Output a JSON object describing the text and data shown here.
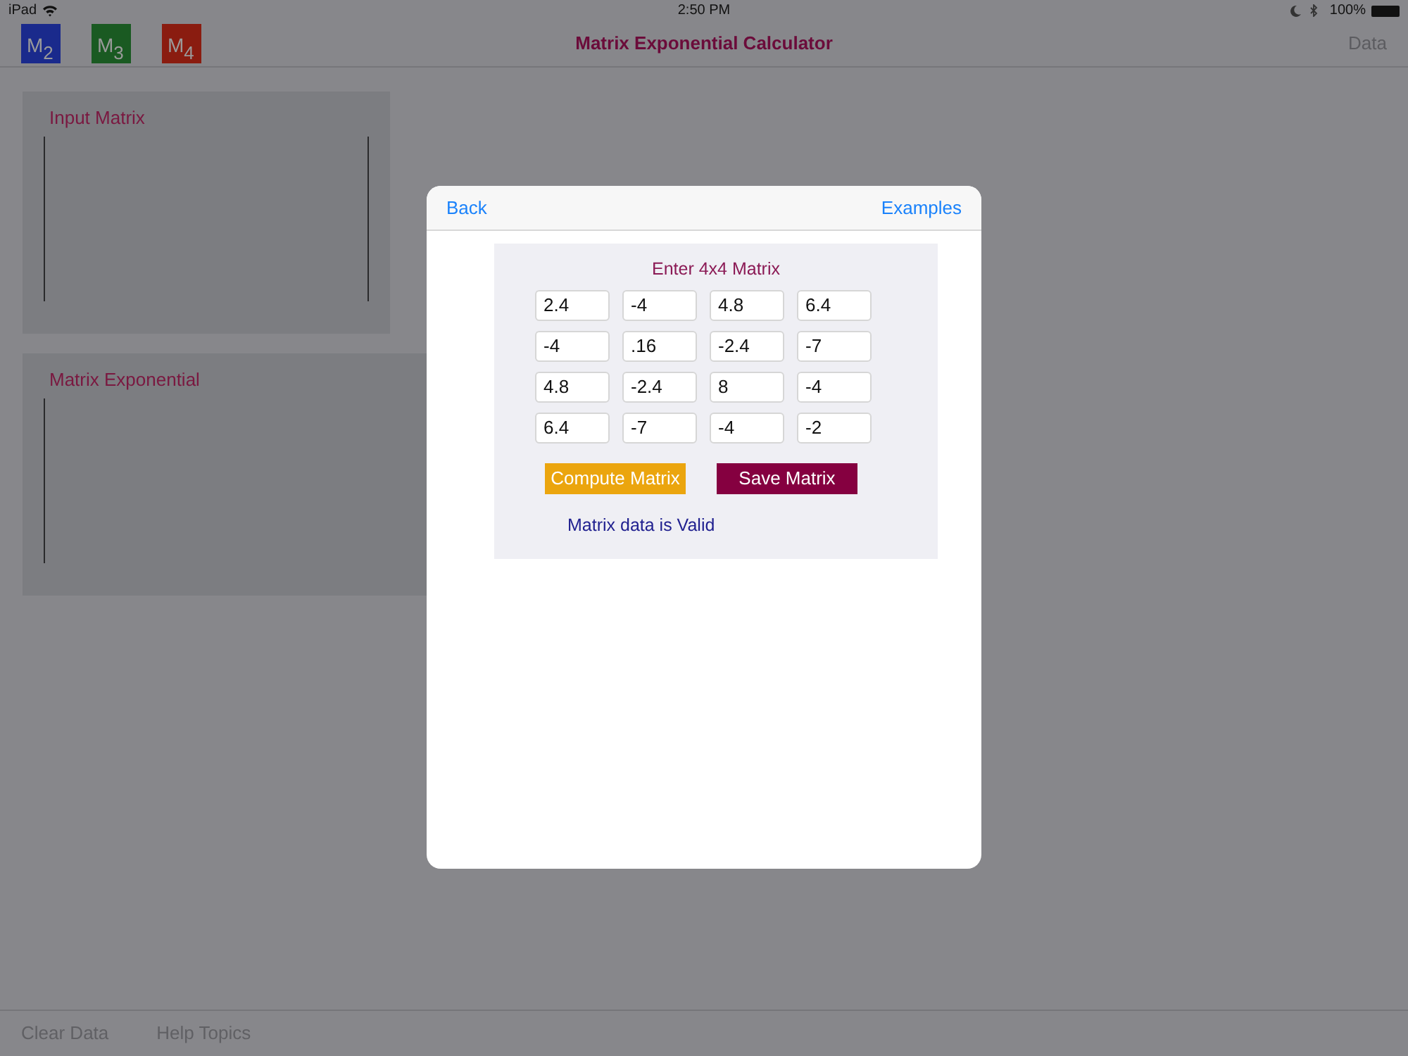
{
  "status_bar": {
    "carrier": "iPad",
    "time": "2:50 PM",
    "battery": "100%"
  },
  "nav": {
    "matrix_buttons": [
      {
        "label": "M",
        "sub": "2",
        "color": "#1a2a8c"
      },
      {
        "label": "M",
        "sub": "3",
        "color": "#1a5a22"
      },
      {
        "label": "M",
        "sub": "4",
        "color": "#8a1c10"
      }
    ],
    "title": "Matrix Exponential Calculator",
    "right": "Data"
  },
  "panels": [
    {
      "title": "Input Matrix",
      "kind": "bracket"
    },
    {
      "title": "Matrix Exponential",
      "kind": "open"
    }
  ],
  "toolbar": [
    "Clear Data",
    "Help Topics"
  ],
  "modal": {
    "back": "Back",
    "examples": "Examples",
    "heading": "Enter 4x4 Matrix",
    "matrix": [
      [
        "2.4",
        "-4",
        "4.8",
        "6.4"
      ],
      [
        "-4",
        ".16",
        "-2.4",
        "-7"
      ],
      [
        "4.8",
        "-2.4",
        "8",
        "-4"
      ],
      [
        "6.4",
        "-7",
        "-4",
        "-2"
      ]
    ],
    "buttons": [
      {
        "label": "Compute Matrix",
        "kind": "compute"
      },
      {
        "label": "Save Matrix",
        "kind": "save"
      }
    ],
    "status": "Matrix data is Valid"
  }
}
